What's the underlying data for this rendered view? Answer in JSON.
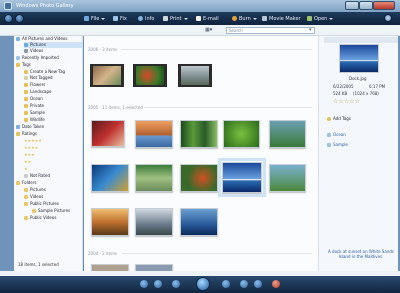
{
  "window": {
    "title": "Windows Photo Gallery"
  },
  "toolbar": {
    "file": "File",
    "fix": "Fix",
    "info": "Info",
    "print": "Print",
    "email": "E-mail",
    "burn": "Burn",
    "movie_maker": "Movie Maker",
    "open": "Open"
  },
  "search": {
    "placeholder": "Search"
  },
  "sidebar": {
    "items": [
      {
        "label": "All Pictures and Videos"
      },
      {
        "label": "Pictures"
      },
      {
        "label": "Videos"
      },
      {
        "label": "Recently Imported"
      },
      {
        "label": "Tags"
      },
      {
        "label": "Create a New Tag"
      },
      {
        "label": "Not Tagged"
      },
      {
        "label": "Flowers"
      },
      {
        "label": "Landscape"
      },
      {
        "label": "Ocean"
      },
      {
        "label": "Private"
      },
      {
        "label": "Sample"
      },
      {
        "label": "Wildlife"
      },
      {
        "label": "Date Taken"
      },
      {
        "label": "Ratings"
      },
      {
        "label": "Not Rated"
      },
      {
        "label": "Folders"
      },
      {
        "label": "Pictures"
      },
      {
        "label": "Videos"
      },
      {
        "label": "Public Pictures"
      },
      {
        "label": "Sample Pictures"
      },
      {
        "label": "Public Videos"
      }
    ],
    "rating_stars": [
      "★★★★★",
      "★★★★",
      "★★★",
      "★★",
      "★"
    ]
  },
  "groups": [
    {
      "label": "2006 - 3 items"
    },
    {
      "label": "2005 - 11 items, 1 selected"
    },
    {
      "label": "2004 - 2 items"
    }
  ],
  "details": {
    "filename": "Dock.jpg",
    "date": "6/22/2005",
    "time": "6:17 PM",
    "size": "524 KB",
    "dimensions": "(1024 x 768)",
    "rating": "☆☆☆☆☆",
    "add_tags": "Add Tags",
    "tags": [
      "Ocean",
      "Sample"
    ],
    "caption": "A dock at sunset on White Sands Island in the Maldives."
  },
  "status": {
    "text": "18 items, 1 selected"
  },
  "colors": {
    "accent": "#2b5d92",
    "selection": "#cfe3f7"
  }
}
